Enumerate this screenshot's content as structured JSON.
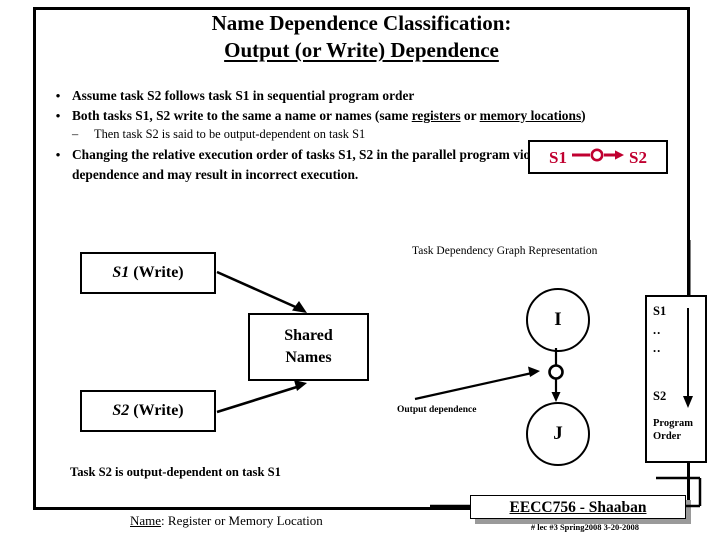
{
  "title": {
    "line1": "Name Dependence Classification:",
    "line2": "Output (or Write) Dependence"
  },
  "bullets": {
    "marker": "•",
    "sub_marker": "–",
    "item1": "Assume  task S2 follows task S1 in sequential program order",
    "item2_a": "Both tasks S1, S2  write to the same  a name or names (same ",
    "item2_u1": "registers",
    "item2_b": " or ",
    "item2_u2": "memory locations",
    "item2_c": ")",
    "item2_sub": "Then task S2 is said to be output-dependent on task S1",
    "item3": "Changing the relative execution order of tasks S1, S2  in the parallel program violates this name dependence and may result in  incorrect execution."
  },
  "red_box": {
    "left_label": "S1",
    "right_label": "S2",
    "color": "#c00030",
    "glyph": "arrow-with-circle-icon"
  },
  "diagram": {
    "s1_write_italic": "S1",
    "s1_write_rest": " (Write)",
    "s2_write_italic": "S2",
    "s2_write_rest": " (Write)",
    "shared_line1": "Shared",
    "shared_line2": "Names",
    "tdg_caption": "Task Dependency Graph Representation",
    "output_dependence_label": "Output dependence",
    "node_i": "I",
    "node_j": "J"
  },
  "program_order": {
    "top": "S1",
    "dots1": "..",
    "dots2": "..",
    "bottom": "S2",
    "caption_line1": "Program",
    "caption_line2": "Order"
  },
  "bottom": {
    "statement": "Task S2 is output-dependent on task S1",
    "name_label": "Name",
    "name_rest": ": Register  or  Memory Location"
  },
  "footer": {
    "course": "EECC756 - Shaaban",
    "sub": "#  lec #3   Spring2008  3-20-2008"
  }
}
